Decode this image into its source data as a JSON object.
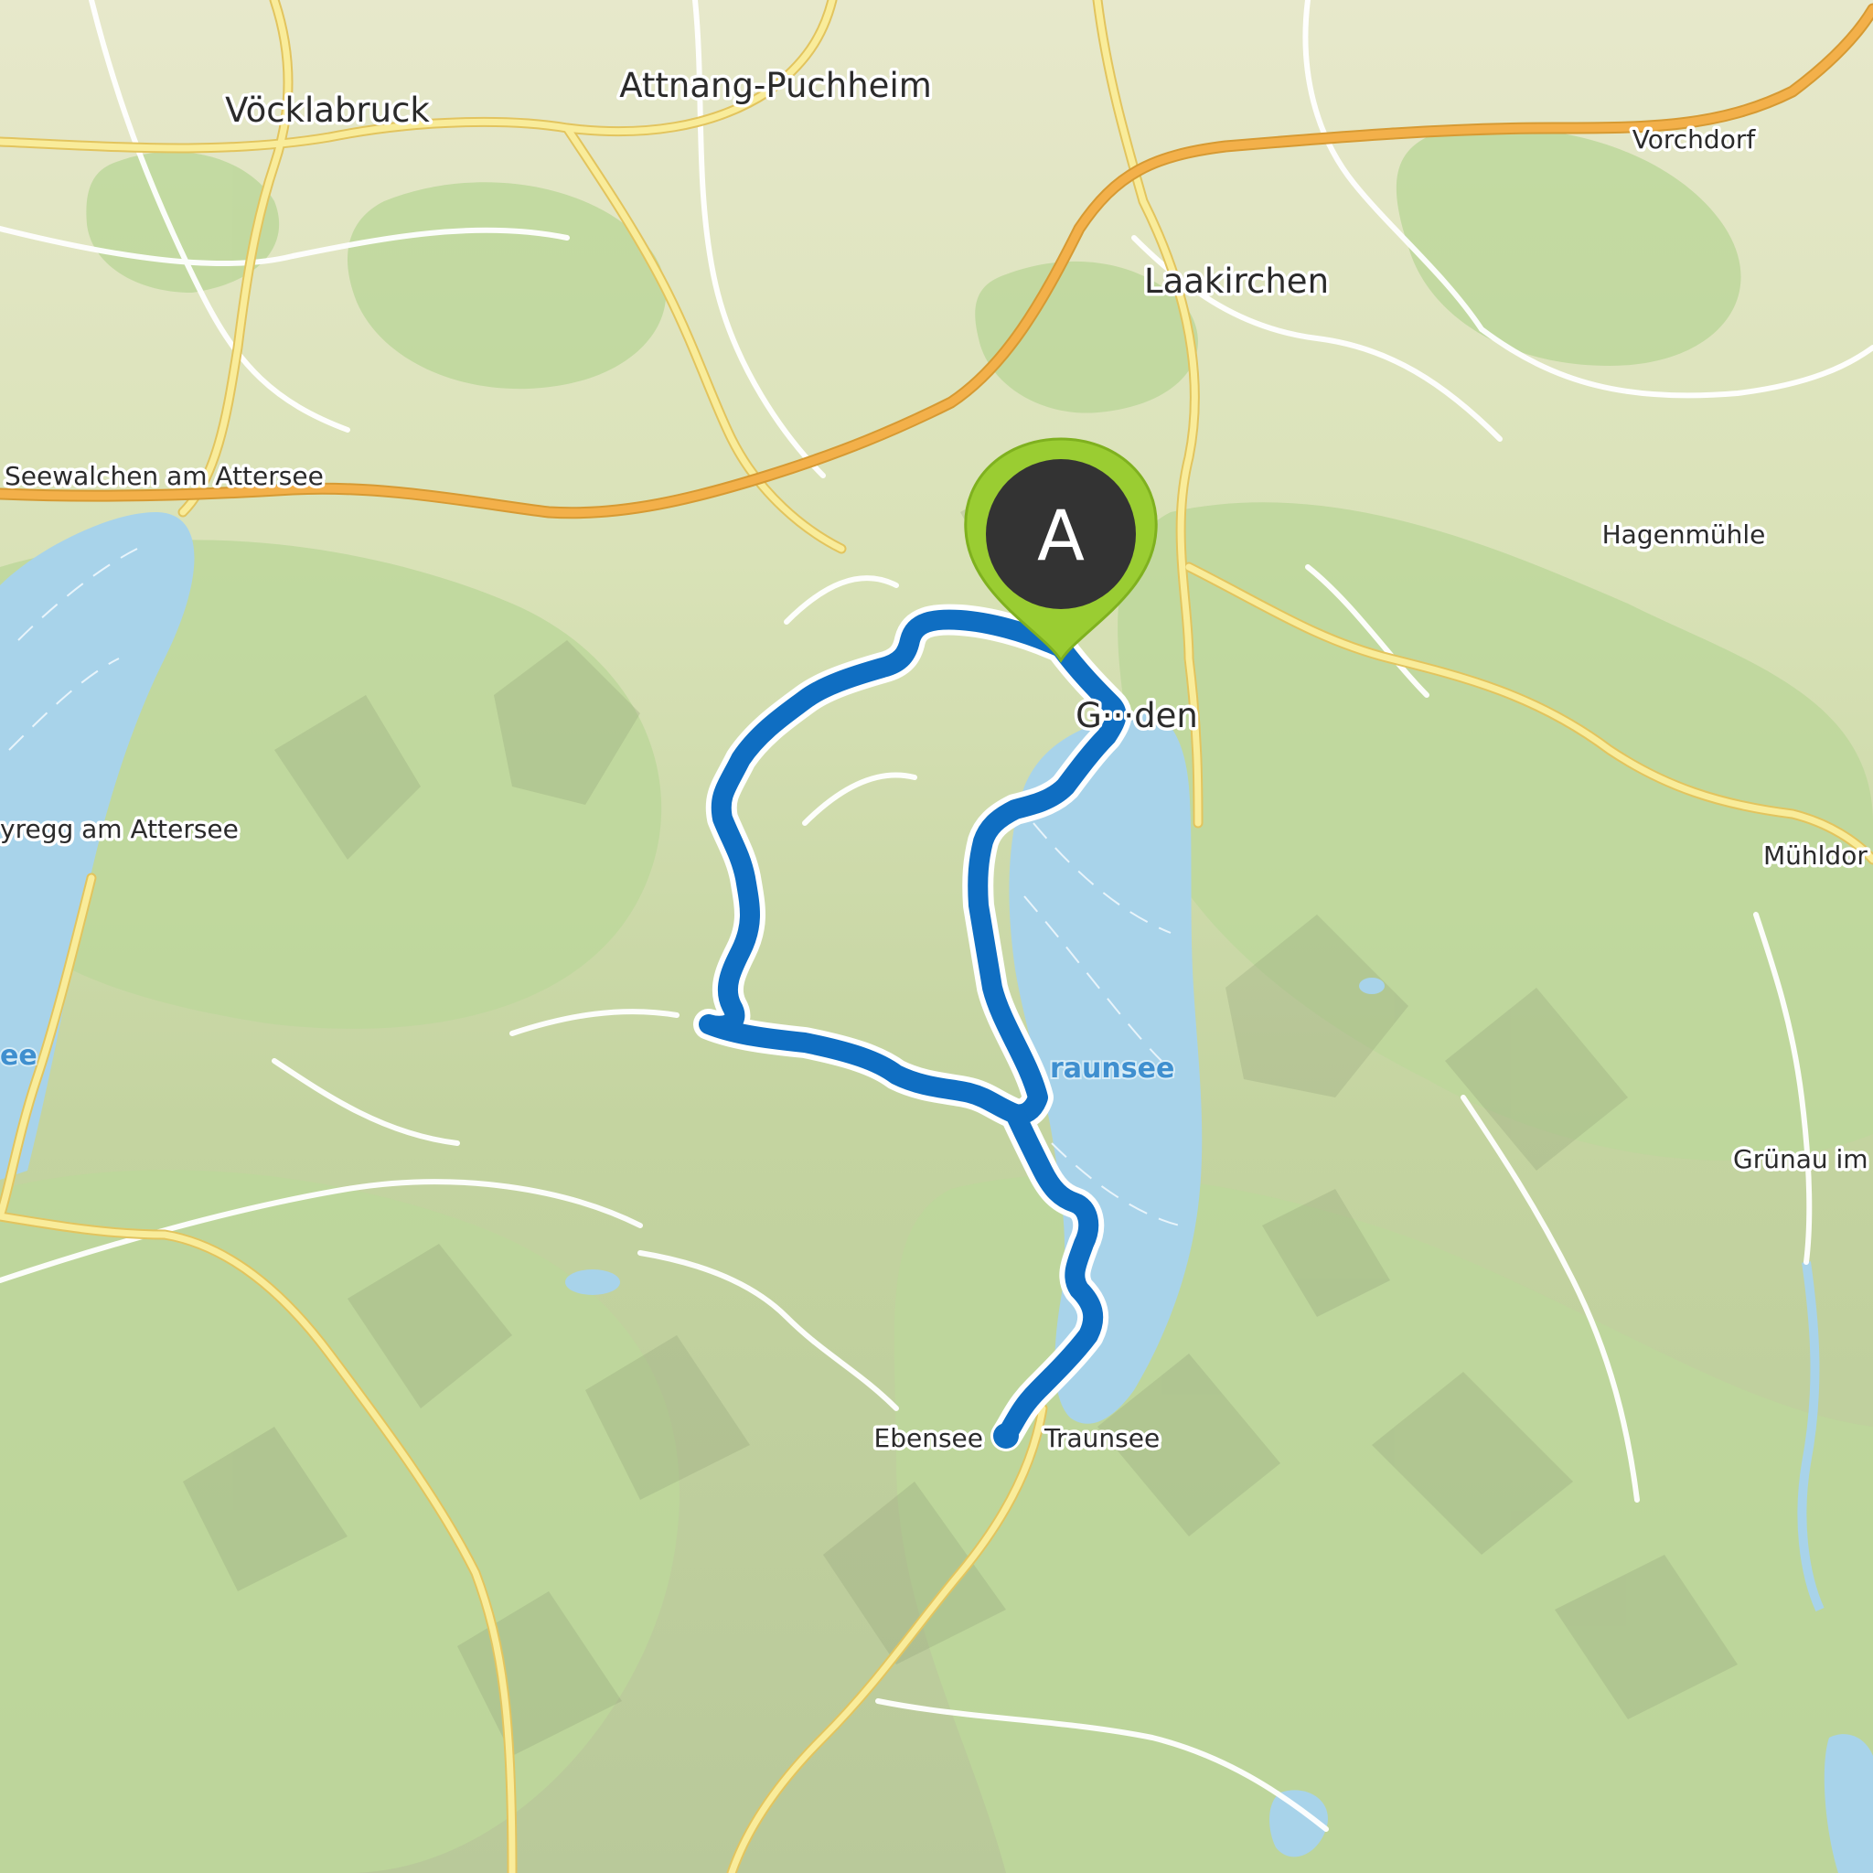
{
  "map": {
    "places": [
      {
        "id": "voecklabruck",
        "name": "Vöcklabruck",
        "kind": "town"
      },
      {
        "id": "attnang",
        "name": "Attnang-Puchheim",
        "kind": "town"
      },
      {
        "id": "laakirchen",
        "name": "Laakirchen",
        "kind": "town"
      },
      {
        "id": "gmunden",
        "name": "G···den",
        "kind": "town"
      },
      {
        "id": "vorchdorf",
        "name": "Vorchdorf",
        "kind": "village"
      },
      {
        "id": "seewalchen",
        "name": "Seewalchen am Attersee",
        "kind": "village"
      },
      {
        "id": "hagenmuehle",
        "name": "Hagenmühle",
        "kind": "village"
      },
      {
        "id": "nussdorf",
        "name": "yregg am Attersee",
        "kind": "village"
      },
      {
        "id": "muehldorf",
        "name": "Mühldor",
        "kind": "village"
      },
      {
        "id": "gruenau",
        "name": "Grünau im",
        "kind": "village"
      },
      {
        "id": "ebensee",
        "name": "Ebensee",
        "kind": "village"
      },
      {
        "id": "ebensee2",
        "name": "Traunsee",
        "kind": "village"
      }
    ],
    "water_labels": {
      "traunsee": "raunsee",
      "attersee": "ee"
    },
    "start_marker": {
      "letter": "A",
      "color": "#9acd32"
    },
    "colors": {
      "route": "#0f6ec2",
      "route_casing": "#ffffff",
      "water": "#a8d3ea",
      "highway": "#f3b04a",
      "main_road": "#f7e27e",
      "forest": "#bcd59a",
      "meadow": "#e4e6c3"
    }
  }
}
